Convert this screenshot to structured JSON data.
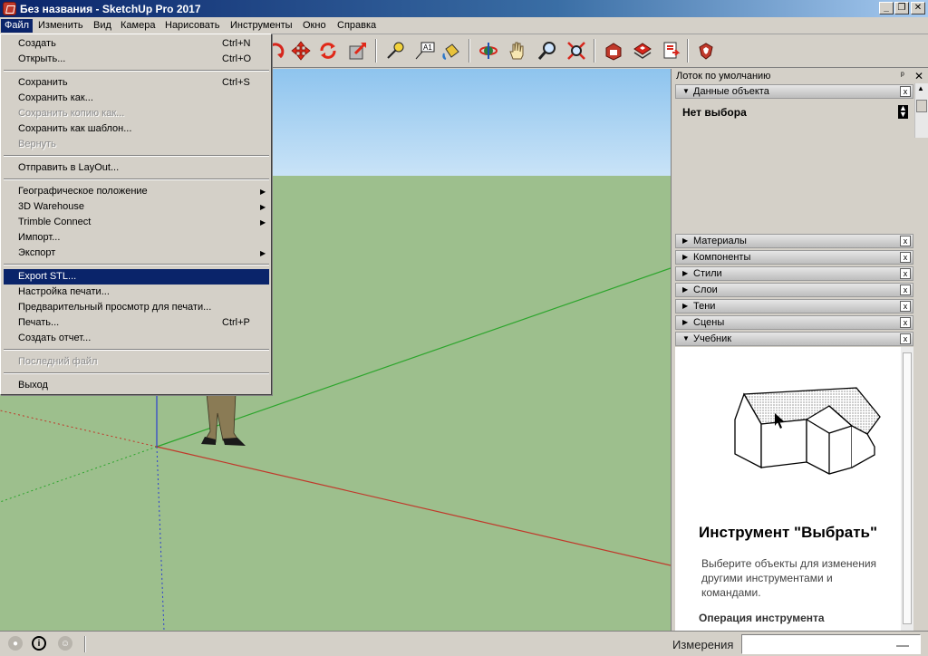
{
  "window": {
    "title": "Без названия - SketchUp Pro 2017",
    "minimize": "_",
    "restore": "❐",
    "close": "✕"
  },
  "menubar": [
    "Файл",
    "Изменить",
    "Вид",
    "Камера",
    "Нарисовать",
    "Инструменты",
    "Окно",
    "Справка"
  ],
  "file_menu": {
    "items": [
      {
        "label": "Создать",
        "shortcut": "Ctrl+N"
      },
      {
        "label": "Открыть...",
        "shortcut": "Ctrl+O"
      },
      {
        "label": "Сохранить",
        "shortcut": "Ctrl+S"
      },
      {
        "label": "Сохранить как..."
      },
      {
        "label": "Сохранить копию как..."
      },
      {
        "label": "Сохранить как шаблон..."
      },
      {
        "label": "Вернуть"
      },
      {
        "label": "Отправить в LayOut..."
      },
      {
        "label": "Географическое положение"
      },
      {
        "label": "3D Warehouse"
      },
      {
        "label": "Trimble Connect"
      },
      {
        "label": "Импорт..."
      },
      {
        "label": "Экспорт"
      },
      {
        "label": "Export STL..."
      },
      {
        "label": "Настройка печати..."
      },
      {
        "label": "Предварительный просмотр для печати..."
      },
      {
        "label": "Печать...",
        "shortcut": "Ctrl+P"
      },
      {
        "label": "Создать отчет..."
      },
      {
        "label": "Последний файл"
      },
      {
        "label": "Выход"
      }
    ],
    "submenu_arrow": "▶"
  },
  "toolbar_icons": [
    "orbit-red-icon",
    "move-icon",
    "rotate-icon",
    "scale-icon",
    "tape-measure-icon",
    "text-icon",
    "paint-bucket-icon",
    "orbit-icon",
    "pan-icon",
    "zoom-icon",
    "zoom-extents-icon",
    "warehouse-icon",
    "components-icon",
    "send-to-layout-icon",
    "extension-warehouse-icon"
  ],
  "tray": {
    "title": "Лоток по умолчанию",
    "pin": "ᵖ",
    "close": "✕",
    "entity_info": {
      "label": "Данные объекта",
      "no_selection": "Нет выбора"
    },
    "panels": [
      "Материалы",
      "Компоненты",
      "Стили",
      "Слои",
      "Тени",
      "Сцены",
      "Учебник"
    ],
    "panel_close": "x",
    "collapsed_arrow": "▶",
    "expanded_arrow": "▼",
    "instructor": {
      "title": "Инструмент \"Выбрать\"",
      "description": "Выберите объекты для изменения другими инструментами и командами.",
      "operation_heading": "Операция инструмента"
    }
  },
  "statusbar": {
    "icons": [
      "geo-location-icon",
      "info-icon",
      "user-icon"
    ],
    "measurements_label": "Измерения",
    "measurements_value": ""
  },
  "colors": {
    "title_active": "#0a246a",
    "menu_highlight": "#0a246a",
    "ground": "#9dbf8d",
    "sky_top": "#8ec4ee",
    "axis_red": "#c0392b",
    "axis_green": "#2ca52c",
    "axis_blue": "#2c3fd0"
  }
}
